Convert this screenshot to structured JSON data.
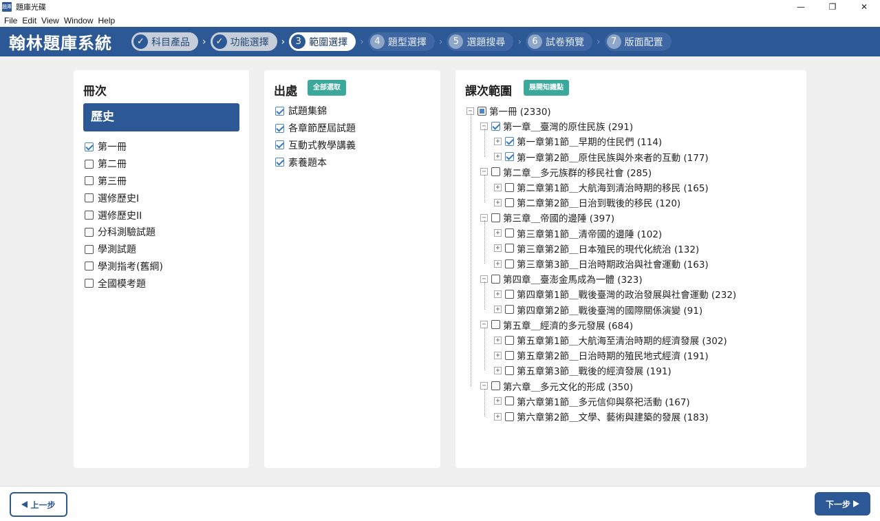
{
  "window": {
    "title": "題庫光碟",
    "icon_text": "題庫",
    "controls": [
      "—",
      "❐",
      "✕"
    ]
  },
  "menu": [
    "File",
    "Edit",
    "View",
    "Window",
    "Help"
  ],
  "header": {
    "brand": "翰林題庫系統",
    "steps": [
      {
        "num": "✓",
        "label": "科目產品",
        "state": "done"
      },
      {
        "num": "✓",
        "label": "功能選擇",
        "state": "done"
      },
      {
        "num": "3",
        "label": "範圍選擇",
        "state": "current"
      },
      {
        "num": "4",
        "label": "題型選擇",
        "state": "todo"
      },
      {
        "num": "5",
        "label": "選題搜尋",
        "state": "todo"
      },
      {
        "num": "6",
        "label": "試卷預覽",
        "state": "todo"
      },
      {
        "num": "7",
        "label": "版面配置",
        "state": "todo"
      }
    ]
  },
  "volumes": {
    "title": "冊次",
    "selected_subject": "歷史",
    "items": [
      {
        "label": "第一冊",
        "checked": true
      },
      {
        "label": "第二冊",
        "checked": false
      },
      {
        "label": "第三冊",
        "checked": false
      },
      {
        "label": "選修歷史I",
        "checked": false
      },
      {
        "label": "選修歷史II",
        "checked": false
      },
      {
        "label": "分科測驗試題",
        "checked": false
      },
      {
        "label": "學測試題",
        "checked": false
      },
      {
        "label": "學測指考(舊綱)",
        "checked": false
      },
      {
        "label": "全國模考題",
        "checked": false
      }
    ]
  },
  "sources": {
    "title": "出處",
    "select_all": "全部選取",
    "items": [
      {
        "label": "試題集錦",
        "checked": true
      },
      {
        "label": "各章節歷屆試題",
        "checked": true
      },
      {
        "label": "互動式教學講義",
        "checked": true
      },
      {
        "label": "素養題本",
        "checked": true
      }
    ]
  },
  "lessons": {
    "title": "課次範圍",
    "expand_button": "展開知識點",
    "tree": [
      {
        "level": 0,
        "label": "第一冊 (2330)",
        "state": "partial",
        "expander": "−"
      },
      {
        "level": 1,
        "label": "第一章＿臺灣的原住民族 (291)",
        "state": "checked",
        "expander": "−"
      },
      {
        "level": 2,
        "label": "第一章第1節＿早期的住民們 (114)",
        "state": "checked",
        "expander": "+"
      },
      {
        "level": 2,
        "label": "第一章第2節＿原住民族與外來者的互動 (177)",
        "state": "checked",
        "expander": "+"
      },
      {
        "level": 1,
        "label": "第二章＿多元族群的移民社會 (285)",
        "state": "none",
        "expander": "−"
      },
      {
        "level": 2,
        "label": "第二章第1節＿大航海到清治時期的移民 (165)",
        "state": "none",
        "expander": "+"
      },
      {
        "level": 2,
        "label": "第二章第2節＿日治到戰後的移民 (120)",
        "state": "none",
        "expander": "+"
      },
      {
        "level": 1,
        "label": "第三章＿帝國的邊陲 (397)",
        "state": "none",
        "expander": "−"
      },
      {
        "level": 2,
        "label": "第三章第1節＿清帝國的邊陲 (102)",
        "state": "none",
        "expander": "+"
      },
      {
        "level": 2,
        "label": "第三章第2節＿日本殖民的現代化統治 (132)",
        "state": "none",
        "expander": "+"
      },
      {
        "level": 2,
        "label": "第三章第3節＿日治時期政治與社會運動 (163)",
        "state": "none",
        "expander": "+"
      },
      {
        "level": 1,
        "label": "第四章＿臺澎金馬成為一體 (323)",
        "state": "none",
        "expander": "−"
      },
      {
        "level": 2,
        "label": "第四章第1節＿戰後臺灣的政治發展與社會運動 (232)",
        "state": "none",
        "expander": "+"
      },
      {
        "level": 2,
        "label": "第四章第2節＿戰後臺灣的國際關係演變 (91)",
        "state": "none",
        "expander": "+"
      },
      {
        "level": 1,
        "label": "第五章＿經濟的多元發展 (684)",
        "state": "none",
        "expander": "−"
      },
      {
        "level": 2,
        "label": "第五章第1節＿大航海至清治時期的經濟發展 (302)",
        "state": "none",
        "expander": "+"
      },
      {
        "level": 2,
        "label": "第五章第2節＿日治時期的殖民地式經濟 (191)",
        "state": "none",
        "expander": "+"
      },
      {
        "level": 2,
        "label": "第五章第3節＿戰後的經濟發展 (191)",
        "state": "none",
        "expander": "+"
      },
      {
        "level": 1,
        "label": "第六章＿多元文化的形成 (350)",
        "state": "none",
        "expander": "−"
      },
      {
        "level": 2,
        "label": "第六章第1節＿多元信仰與祭祀活動 (167)",
        "state": "none",
        "expander": "+"
      },
      {
        "level": 2,
        "label": "第六章第2節＿文學、藝術與建築的發展 (183)",
        "state": "none",
        "expander": "+"
      }
    ]
  },
  "footer": {
    "prev": "上一步",
    "next": "下一步"
  },
  "colors": {
    "brand_blue": "#2d5896",
    "accent_teal": "#3aa89b"
  }
}
